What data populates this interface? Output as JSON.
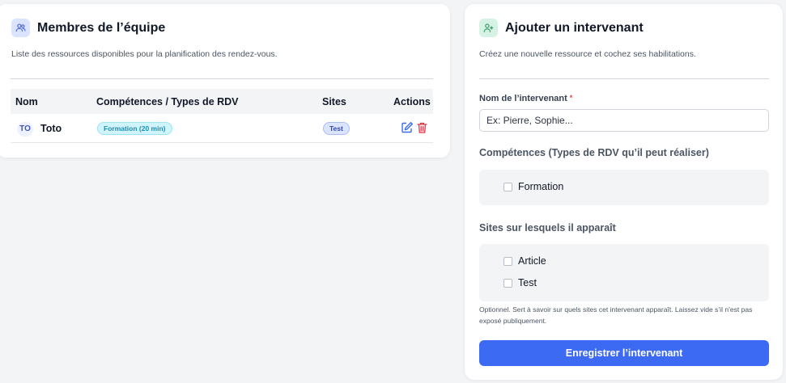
{
  "team": {
    "title": "Membres de l’équipe",
    "subtitle": "Liste des ressources disponibles pour la planification des rendez-vous.",
    "icon": "users-icon",
    "columns": [
      "Nom",
      "Compétences / Types de RDV",
      "Sites",
      "Actions"
    ],
    "rows": [
      {
        "initials": "TO",
        "name": "Toto",
        "skill": "Formation (20 min)",
        "site": "Test",
        "edit_icon": "edit-icon",
        "delete_icon": "trash-icon"
      }
    ]
  },
  "form": {
    "title": "Ajouter un intervenant",
    "subtitle": "Créez une nouvelle ressource et cochez ses habilitations.",
    "icon": "user-plus-icon",
    "name_label": "Nom de l’intervenant",
    "required_mark": "*",
    "name_placeholder": "Ex: Pierre, Sophie...",
    "name_value": "",
    "skills_label": "Compétences (Types de RDV qu’il peut réaliser)",
    "skills": [
      "Formation"
    ],
    "sites_label": "Sites sur lesquels il apparaît",
    "sites": [
      "Article",
      "Test"
    ],
    "hint": "Optionnel. Sert à savoir sur quels sites cet intervenant apparaît. Laissez vide s’il n’est pas exposé publiquement.",
    "submit_label": "Enregistrer l’intervenant"
  },
  "colors": {
    "accent": "#3d6af3",
    "skill_pill": "#cff4fb",
    "site_pill": "#dbe4fe",
    "danger": "#dc3545"
  }
}
